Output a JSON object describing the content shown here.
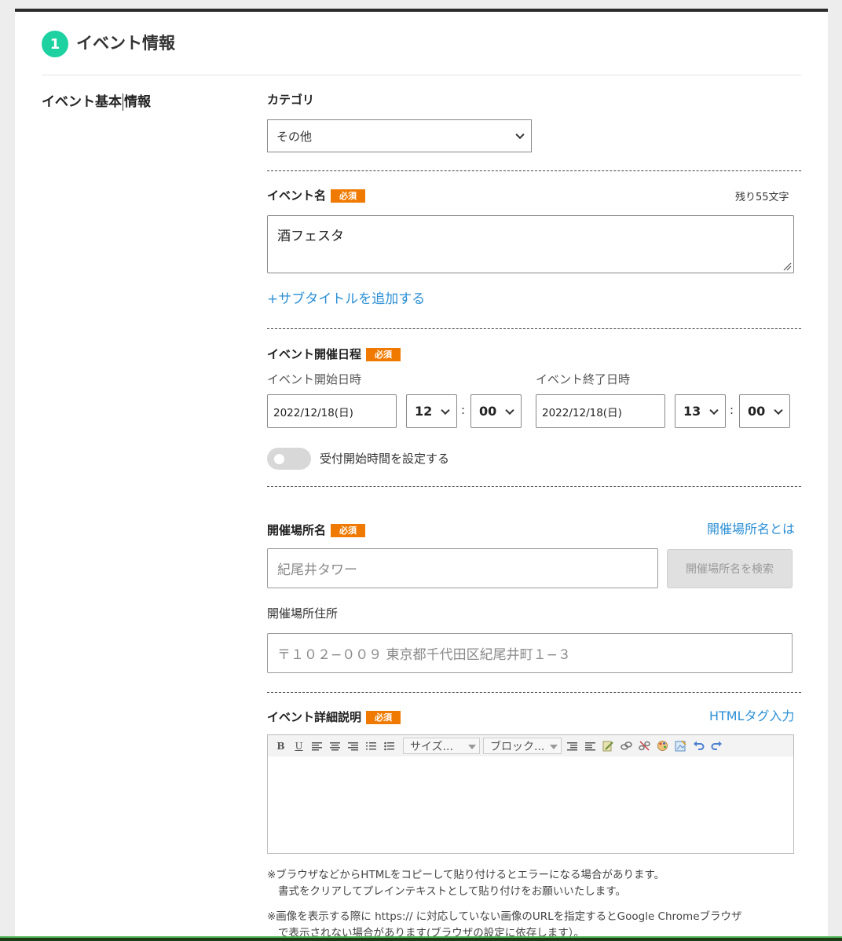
{
  "section": {
    "step_number": "1",
    "title": "イベント情報"
  },
  "basic_info": {
    "heading_part1": "イベント基本",
    "heading_part2": "情報"
  },
  "category": {
    "label": "カテゴリ",
    "selected": "その他"
  },
  "event_name": {
    "label": "イベント名",
    "required": "必須",
    "counter": "残り55文字",
    "value": "酒フェスタ",
    "add_subtitle": "+サブタイトルを追加する"
  },
  "schedule": {
    "label": "イベント開催日程",
    "required": "必須",
    "start_label": "イベント開始日時",
    "start_date": "2022/12/18(日)",
    "start_hour": "12",
    "start_minute": "00",
    "end_label": "イベント終了日時",
    "end_date": "2022/12/18(日)",
    "end_hour": "13",
    "end_minute": "00",
    "colon": ":",
    "reception_toggle_label": "受付開始時間を設定する",
    "reception_toggle_on": false
  },
  "venue": {
    "label": "開催場所名",
    "required": "必須",
    "help_link": "開催場所名とは",
    "name_placeholder": "紀尾井タワー",
    "search_button": "開催場所名を検索",
    "address_label": "開催場所住所",
    "address_placeholder": "〒１０２−００９ 東京都千代田区紀尾井町１−３"
  },
  "details": {
    "label": "イベント詳細説明",
    "required": "必須",
    "html_link": "HTMLタグ入力",
    "toolbar": {
      "bold": "B",
      "underline": "U",
      "size_select": "サイズ...",
      "block_select": "ブロック..."
    },
    "note1_line1": "※ブラウザなどからHTMLをコピーして貼り付けるとエラーになる場合があります。",
    "note1_line2": "書式をクリアしてプレインテキストとして貼り付けをお願いいたします。",
    "note2_line1": "※画像を表示する際に https:// に対応していない画像のURLを指定するとGoogle Chromeブラウザ",
    "note2_line2": "で表示されない場合があります(ブラウザの設定に依存します）。"
  },
  "colors": {
    "accent_green": "#1dd1a1",
    "required_orange": "#f07a00",
    "link_blue": "#2b8fd6"
  }
}
